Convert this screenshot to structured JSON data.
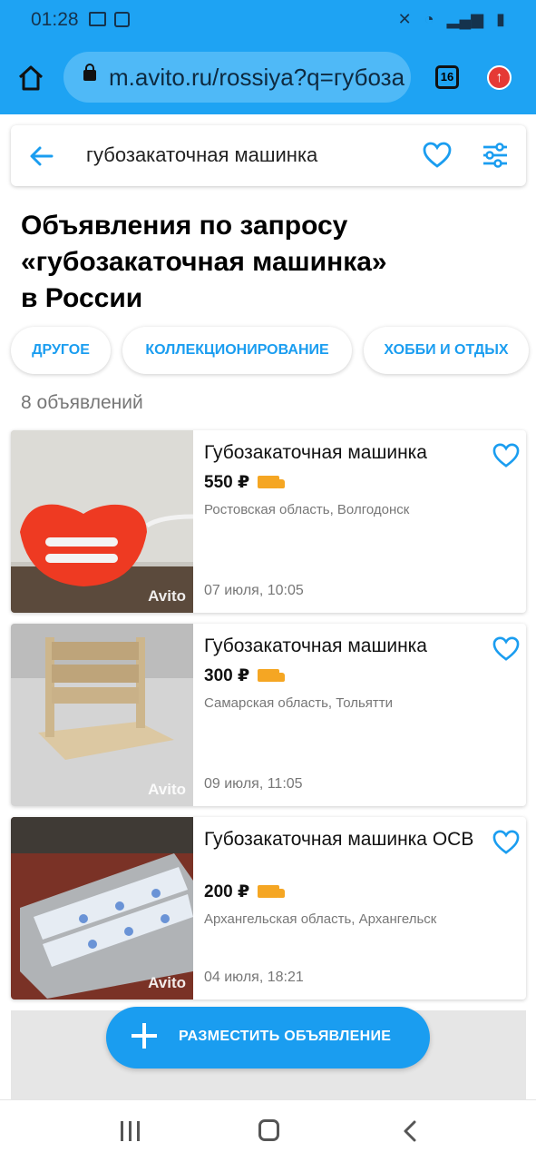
{
  "status_bar": {
    "time": "01:28"
  },
  "browser": {
    "url": "m.avito.ru/rossiya?q=губоза",
    "tab_count": "16"
  },
  "search": {
    "query": "губозакаточная машинка"
  },
  "page": {
    "title_lines": [
      "Объявления по запросу",
      "«губозакаточная машинка»",
      "в России"
    ],
    "results_count": "8 объявлений"
  },
  "categories": [
    "ДРУГОЕ",
    "КОЛЛЕКЦИОНИРОВАНИЕ",
    "ХОББИ И ОТДЫХ"
  ],
  "listings": [
    {
      "title": "Губозакаточная машинка",
      "price": "550 ₽",
      "location": "Ростовская область, Волгодонск",
      "date": "07 июля, 10:05",
      "watermark": "Avito"
    },
    {
      "title": "Губозакаточная машинка",
      "price": "300 ₽",
      "location": "Самарская область, Тольятти",
      "date": "09 июля, 11:05",
      "watermark": "Avito"
    },
    {
      "title": "Губозакаточная машинка ОСВ",
      "price": "200 ₽",
      "location": "Архангельская область, Архангельск",
      "date": "04 июля, 18:21",
      "watermark": "Avito"
    }
  ],
  "cta": {
    "label": "РАЗМЕСТИТЬ ОБЪЯВЛЕНИЕ"
  },
  "colors": {
    "browser_bar": "#1ea3f3",
    "accent": "#1a9df0",
    "delivery": "#f5a623"
  }
}
